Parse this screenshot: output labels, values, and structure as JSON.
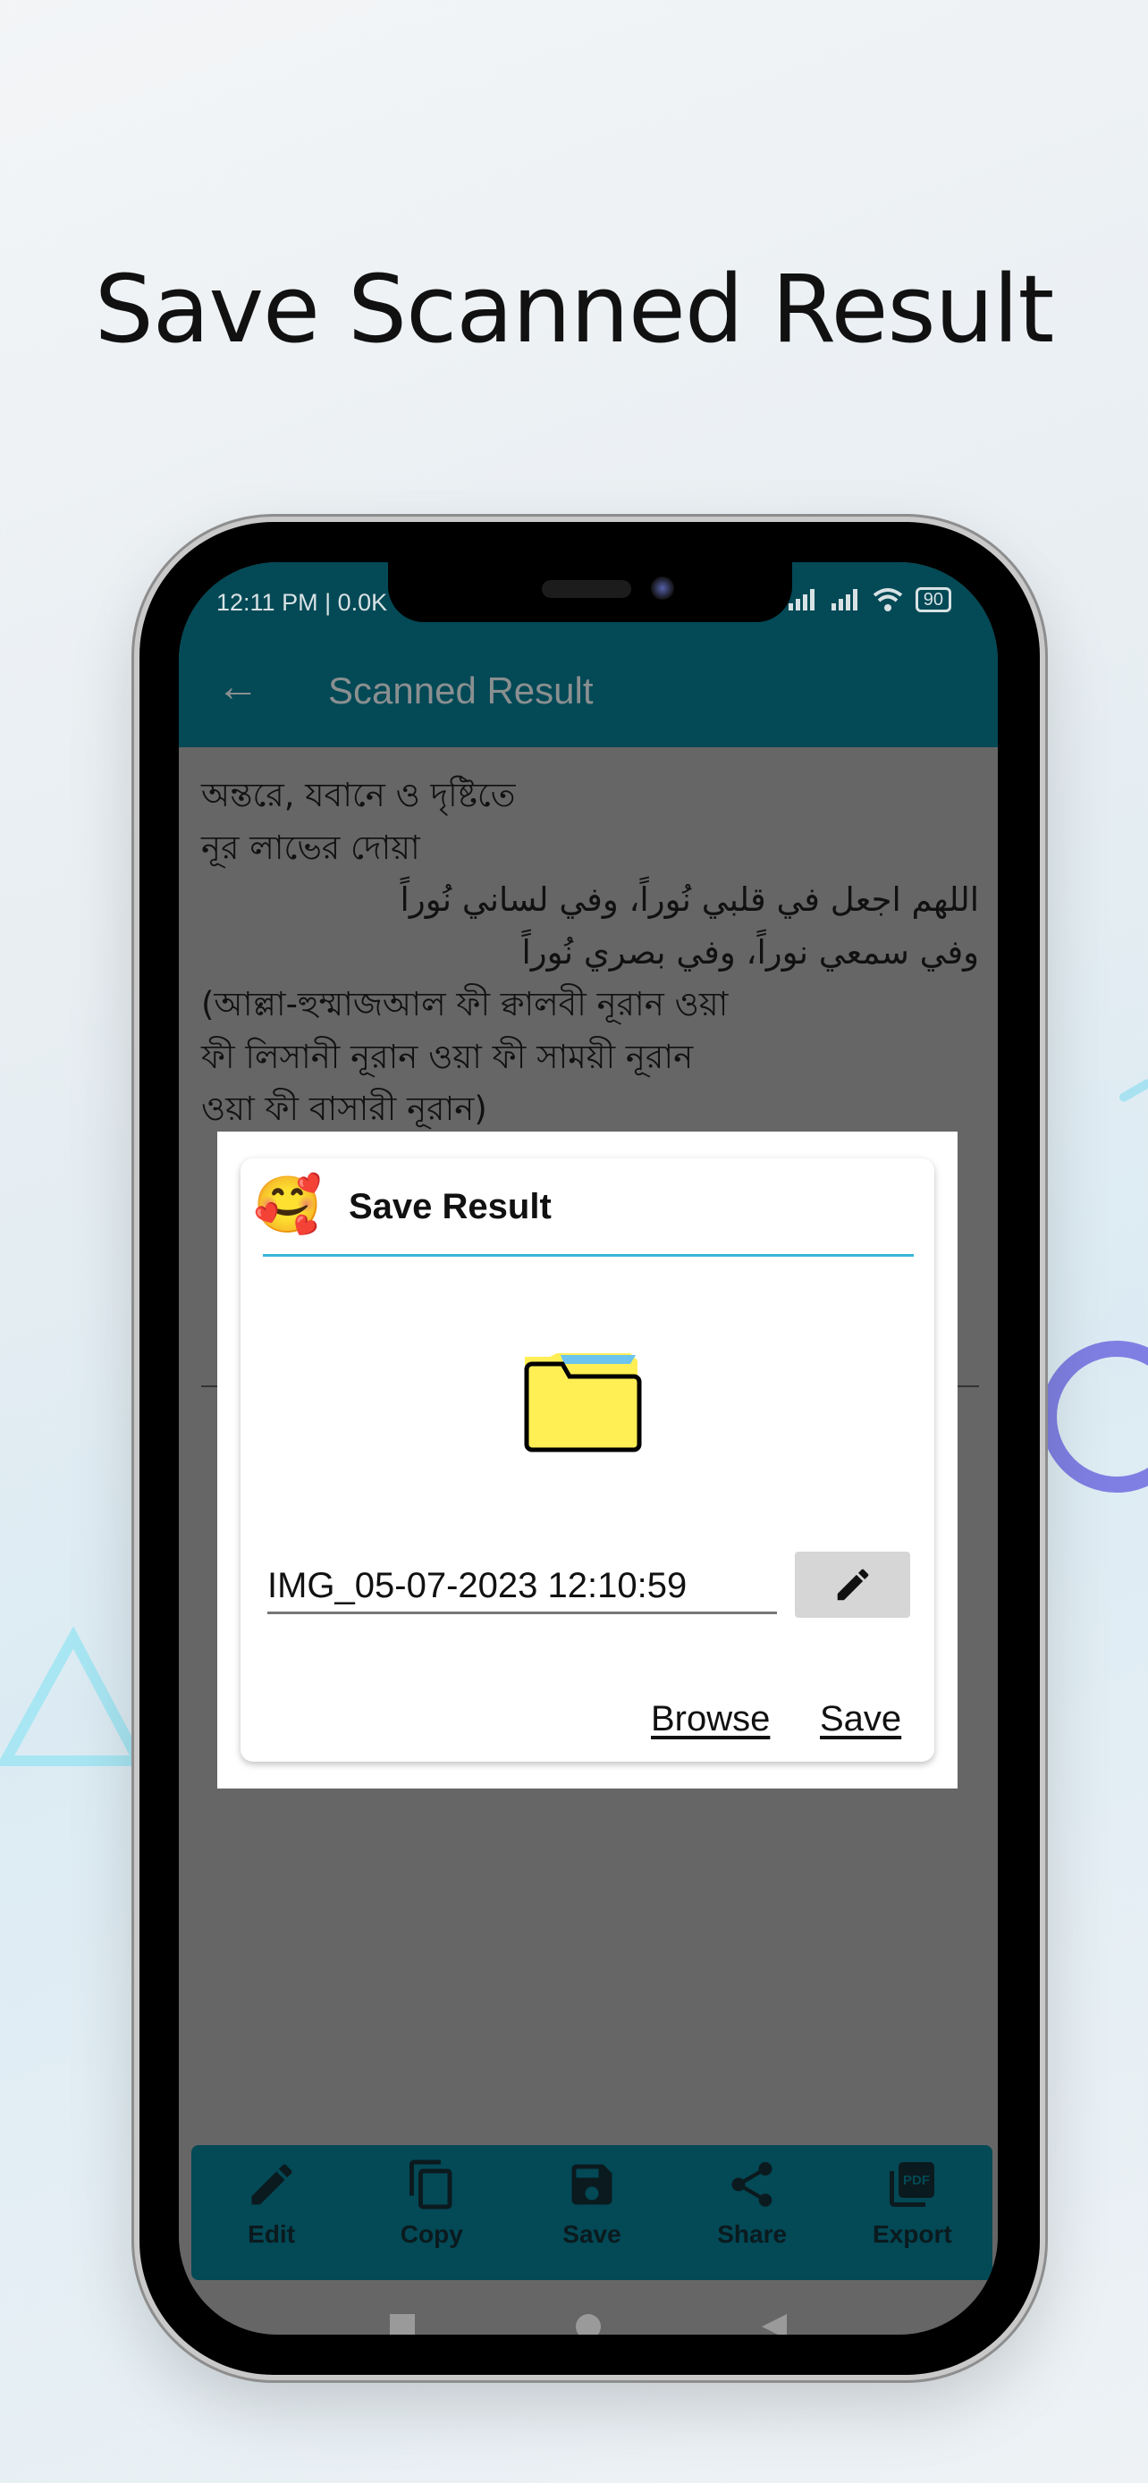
{
  "headline": "Save Scanned Result",
  "status_bar": {
    "time": "12:11 PM | 0.0K",
    "battery": "90"
  },
  "app_bar": {
    "title": "Scanned Result",
    "back_icon": "arrow-left-icon"
  },
  "content_lines": [
    {
      "text": "অন্তরে, যবানে ও দৃষ্টিতে",
      "dir": "ltr"
    },
    {
      "text": "নূর লাভের দোয়া",
      "dir": "ltr"
    },
    {
      "text": "اللهم اجعل في قلبي نُوراً، وفي لساني نُوراً",
      "dir": "rtl"
    },
    {
      "text": "وفي سمعي نوراً، وفي بصري نُوراً",
      "dir": "rtl"
    },
    {
      "text": "(আল্লা-হুম্মাজআল ফী ক্বালবী নূরান ওয়া",
      "dir": "ltr"
    },
    {
      "text": "ফী লিসানী নূরান ওয়া ফী সাময়ী নূরান",
      "dir": "ltr"
    },
    {
      "text": "ওয়া ফী বাসারী নূরান)",
      "dir": "ltr"
    }
  ],
  "bottom_bar": [
    {
      "label": "Edit",
      "icon": "pencil-icon"
    },
    {
      "label": "Copy",
      "icon": "copy-icon"
    },
    {
      "label": "Save",
      "icon": "floppy-disk-icon"
    },
    {
      "label": "Share",
      "icon": "share-icon"
    },
    {
      "label": "Export",
      "icon": "pdf-icon"
    }
  ],
  "dialog": {
    "title": "Save Result",
    "emoji": "🥰",
    "filename": "IMG_05-07-2023 12:10:59",
    "browse_label": "Browse",
    "save_label": "Save"
  },
  "colors": {
    "app_bar": "#034956",
    "accent_line": "#39b6d6",
    "folder": "#ffef55",
    "scrim": "#666666"
  }
}
